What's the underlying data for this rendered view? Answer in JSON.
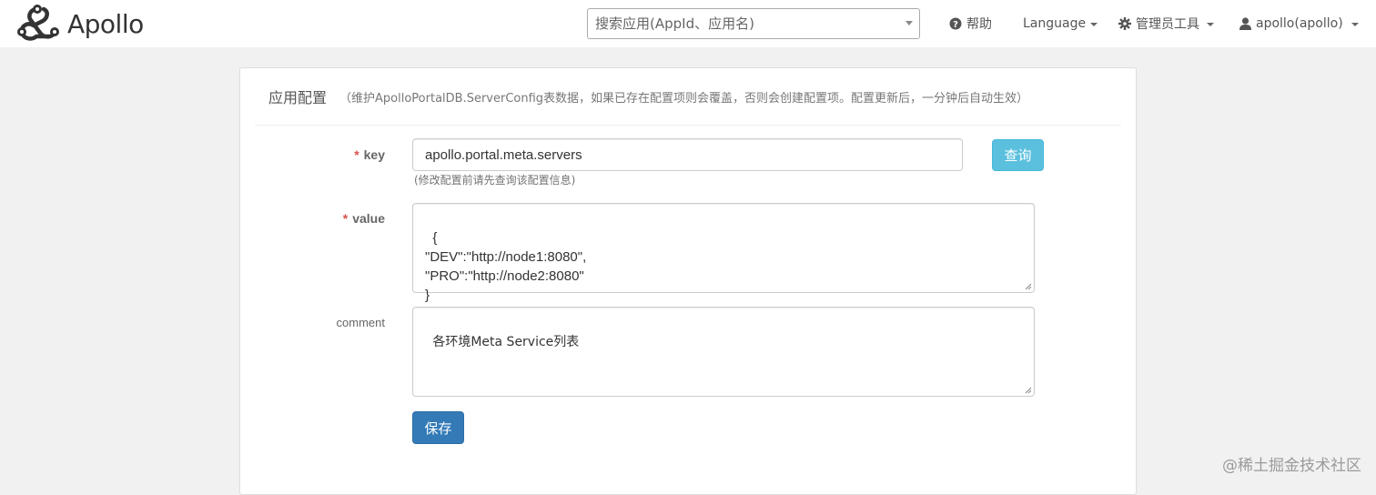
{
  "app": {
    "name": "Apollo"
  },
  "navbar": {
    "search_placeholder": "搜索应用(AppId、应用名)",
    "help_label": "帮助",
    "language_label": "Language",
    "admin_tools_label": "管理员工具",
    "user_label": "apollo(apollo)"
  },
  "panel": {
    "title": "应用配置",
    "hint": "（维护ApolloPortalDB.ServerConfig表数据，如果已存在配置项则会覆盖，否则会创建配置项。配置更新后，一分钟后自动生效）"
  },
  "form": {
    "required_mark": "*",
    "key_label": "key",
    "key_value": "apollo.portal.meta.servers",
    "key_help": "(修改配置前请先查询该配置信息)",
    "query_button": "查询",
    "value_label": "value",
    "value_text": "{\n\"DEV\":\"http://node1:8080\",\n\"PRO\":\"http://node2:8080\"\n}",
    "comment_label": "comment",
    "comment_text": "各环境Meta Service列表",
    "save_button": "保存"
  },
  "watermark": "@稀土掘金技术社区",
  "colors": {
    "primary": "#337ab7",
    "info": "#5bc0de",
    "required": "#d9534f",
    "background": "#f1f1f1"
  },
  "icons": [
    "apollo-logo-icon",
    "question-circle-icon",
    "gear-icon",
    "user-icon",
    "caret-down-icon"
  ]
}
